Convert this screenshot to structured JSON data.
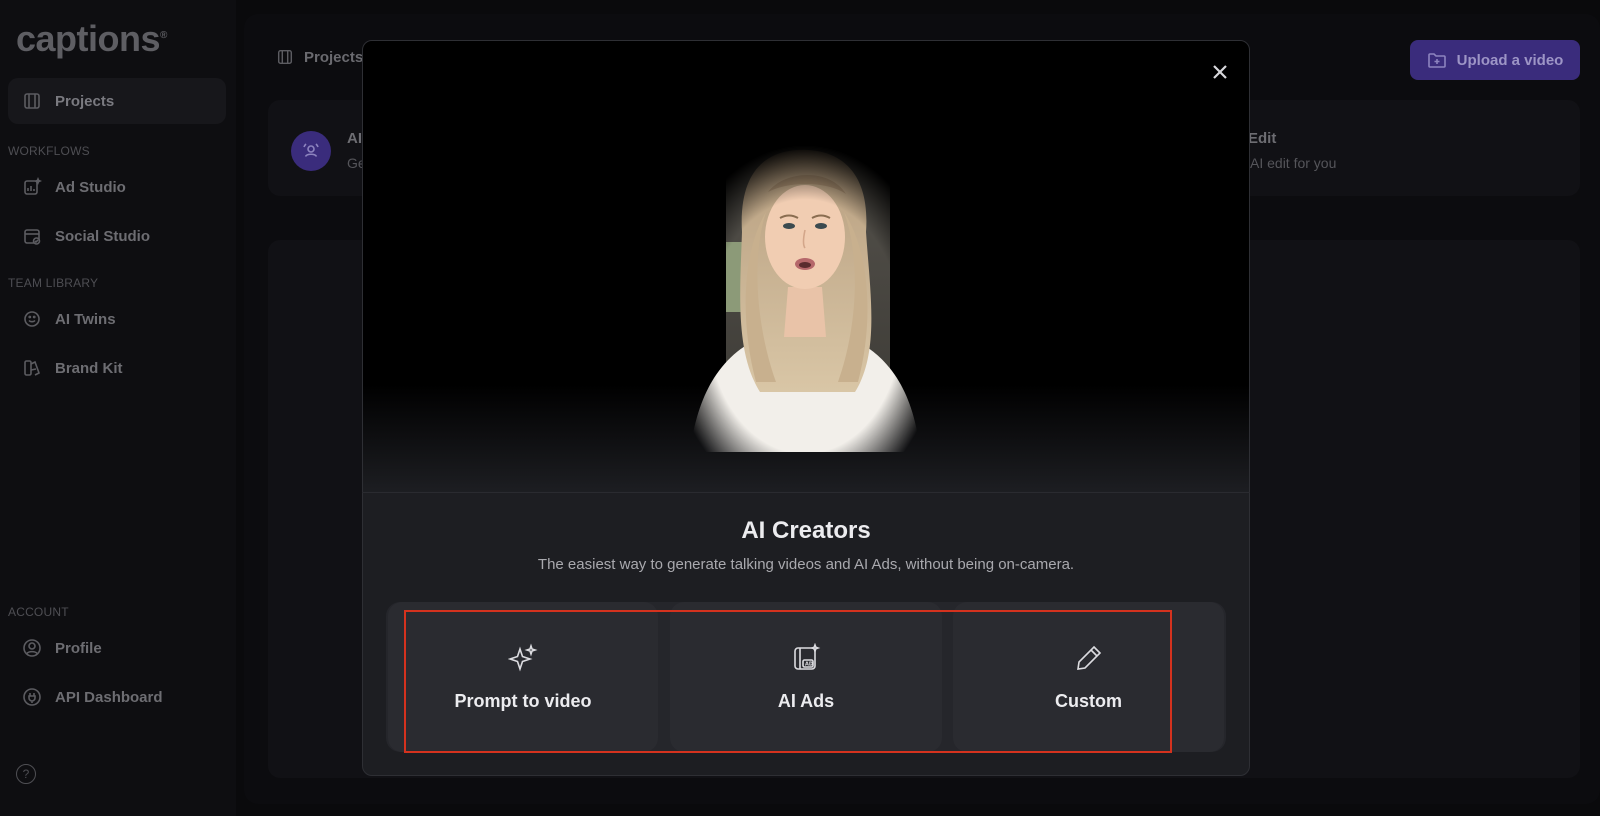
{
  "app": {
    "logo": "captions"
  },
  "sidebar": {
    "projects": "Projects",
    "workflows_label": "WORKFLOWS",
    "ad_studio": "Ad Studio",
    "social_studio": "Social Studio",
    "team_library_label": "TEAM LIBRARY",
    "ai_twins": "AI Twins",
    "brand_kit": "Brand Kit",
    "account_label": "ACCOUNT",
    "profile": "Profile",
    "api_dashboard": "API Dashboard",
    "help": "?"
  },
  "header": {
    "breadcrumb": "Projects",
    "upload_label": "Upload a video"
  },
  "strip": {
    "left_title": "AI",
    "left_sub": "Ge",
    "right_title": "Edit",
    "right_sub": "AI edit for you"
  },
  "modal": {
    "title": "AI Creators",
    "subtitle": "The easiest way to generate talking videos and AI Ads, without being on-camera.",
    "options": [
      {
        "label": "Prompt to video",
        "icon": "sparkle-icon"
      },
      {
        "label": "AI Ads",
        "icon": "ad-film-icon"
      },
      {
        "label": "Custom",
        "icon": "pencil-icon"
      }
    ]
  },
  "colors": {
    "accent": "#3a2c7c",
    "highlight": "#d4321e",
    "modal_bg": "#1d1e22"
  }
}
